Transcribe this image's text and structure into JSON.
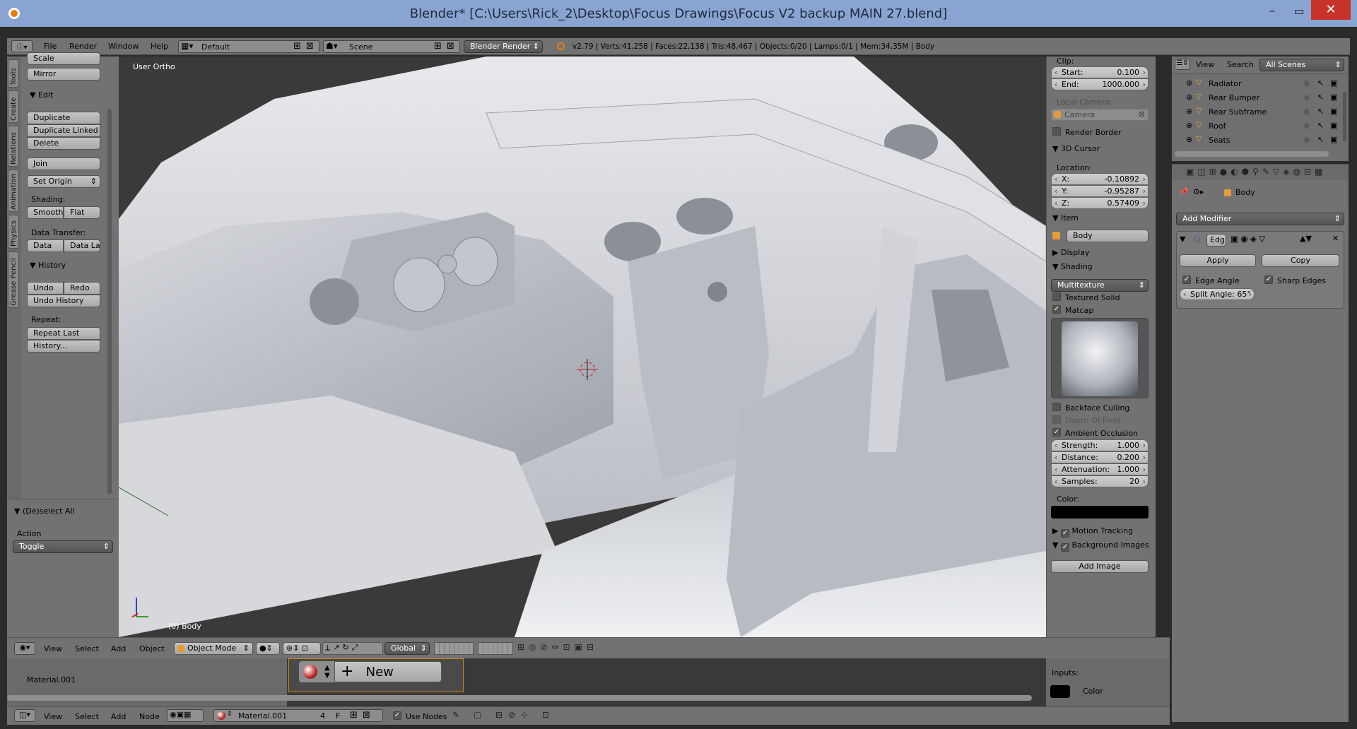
{
  "window": {
    "title": "Blender* [C:\\Users\\Rick_2\\Desktop\\Focus Drawings\\Focus V2 backup MAIN 27.blend]"
  },
  "topbar": {
    "menus": [
      "File",
      "Render",
      "Window",
      "Help"
    ],
    "layout": "Default",
    "scene": "Scene",
    "engine": "Blender Render",
    "stats": "v2.79 | Verts:41,258 | Faces:22,138 | Tris:48,467 | Objects:0/20 | Lamps:0/1 | Mem:34.35M | Body"
  },
  "tooltabs": [
    "Tools",
    "Create",
    "Relations",
    "Animation",
    "Physics",
    "Grease Pencil"
  ],
  "toolshelf": {
    "scale": "Scale",
    "mirror": "Mirror",
    "edit_header": "Edit",
    "duplicate": "Duplicate",
    "duplicate_linked": "Duplicate Linked",
    "delete": "Delete",
    "join": "Join",
    "set_origin": "Set Origin",
    "shading_label": "Shading:",
    "smooth": "Smooth",
    "flat": "Flat",
    "data_transfer_label": "Data Transfer:",
    "data": "Data",
    "data_la": "Data La",
    "history_header": "History",
    "undo": "Undo",
    "redo": "Redo",
    "undo_history": "Undo History",
    "repeat_label": "Repeat:",
    "repeat_last": "Repeat Last",
    "history": "History...",
    "op_header": "(De)select All",
    "action_label": "Action",
    "action_value": "Toggle"
  },
  "viewport": {
    "view_label": "User Ortho",
    "object_label": "(0) Body",
    "menus": [
      "View",
      "Select",
      "Add",
      "Object"
    ],
    "mode": "Object Mode",
    "orientation": "Global"
  },
  "npanel": {
    "clip_label": "Clip:",
    "start_k": "Start:",
    "start_v": "0.100",
    "end_k": "End:",
    "end_v": "1000.000",
    "local_camera": "Local Camera:",
    "camera": "Camera",
    "render_border": "Render Border",
    "cursor_header": "3D Cursor",
    "location": "Location:",
    "x_k": "X:",
    "x_v": "-0.10892",
    "y_k": "Y:",
    "y_v": "-0.95287",
    "z_k": "Z:",
    "z_v": "0.57409",
    "item_header": "Item",
    "item_name": "Body",
    "display_header": "Display",
    "shading_header": "Shading",
    "shading_mode": "Multitexture",
    "textured_solid": "Textured Solid",
    "matcap": "Matcap",
    "backface": "Backface Culling",
    "dof": "Depth Of Field",
    "ao": "Ambient Occlusion",
    "strength_k": "Strength:",
    "strength_v": "1.000",
    "distance_k": "Distance:",
    "distance_v": "0.200",
    "atten_k": "Attenuation:",
    "atten_v": "1.000",
    "samples_k": "Samples:",
    "samples_v": "20",
    "color_label": "Color:",
    "motion_tracking": "Motion Tracking",
    "bg_images": "Background Images",
    "add_image": "Add Image"
  },
  "outliner": {
    "menus": [
      "View",
      "Search"
    ],
    "scenes": "All Scenes",
    "items": [
      "Radiator",
      "Rear Bumper",
      "Rear Subframe",
      "Roof",
      "Seats"
    ]
  },
  "properties": {
    "object": "Body",
    "add_modifier": "Add Modifier",
    "mod_name": "Edg",
    "apply": "Apply",
    "copy": "Copy",
    "edge_angle": "Edge Angle",
    "sharp_edges": "Sharp Edges",
    "split_angle": "Split Angle: 65°"
  },
  "node_editor": {
    "material": "Material.001",
    "new": "New",
    "inputs": "Inputs:",
    "color": "Color",
    "menus": [
      "View",
      "Select",
      "Add",
      "Node"
    ],
    "mat_field": "Material.001",
    "users": "4",
    "fake": "F",
    "use_nodes": "Use Nodes"
  }
}
